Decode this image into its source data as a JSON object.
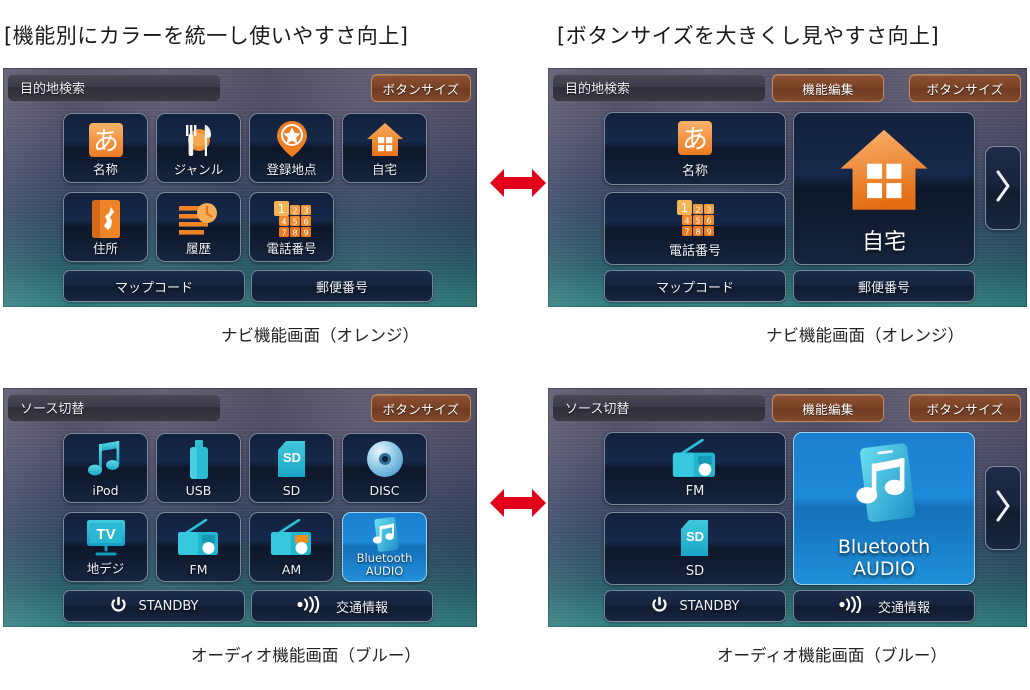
{
  "headings": {
    "left": "[機能別にカラーを統一し使いやすさ向上]",
    "right": "[ボタンサイズを大きくし見やすさ向上]"
  },
  "captions": {
    "nav_left": "ナビ機能画面（オレンジ）",
    "nav_right": "ナビ機能画面（オレンジ）",
    "audio_left": "オーディオ機能画面（ブルー）",
    "audio_right": "オーディオ機能画面（ブルー）"
  },
  "colors": {
    "accent_orange": "#F2903C",
    "accent_blue": "#29B6D8",
    "selected_blue": "#1E8AD8",
    "arrow_red": "#E3001B",
    "topbtn_brown": "#7A4327",
    "tile_navy": "#12213C"
  },
  "common": {
    "button_size_label": "ボタンサイズ",
    "function_edit_label": "機能編集",
    "next_page_icon": "chevron-right-icon"
  },
  "panels": {
    "nav_small": {
      "title": "目的地検索",
      "has_function_edit": false,
      "has_pager": false,
      "tiles": [
        {
          "label": "名称",
          "icon": "kana-a-icon"
        },
        {
          "label": "ジャンル",
          "icon": "genre-cutlery-icon"
        },
        {
          "label": "登録地点",
          "icon": "map-pin-star-icon"
        },
        {
          "label": "自宅",
          "icon": "home-icon"
        },
        {
          "label": "住所",
          "icon": "address-book-icon"
        },
        {
          "label": "履歴",
          "icon": "history-clock-icon"
        },
        {
          "label": "電話番号",
          "icon": "keypad-icon"
        }
      ],
      "bottom": [
        {
          "label": "マップコード",
          "icon": null
        },
        {
          "label": "郵便番号",
          "icon": null
        }
      ]
    },
    "nav_large": {
      "title": "目的地検索",
      "has_function_edit": true,
      "has_pager": true,
      "tiles": [
        {
          "label": "名称",
          "icon": "kana-a-icon"
        },
        {
          "label": "電話番号",
          "icon": "keypad-icon"
        },
        {
          "label": "自宅",
          "icon": "home-icon"
        }
      ],
      "bottom": [
        {
          "label": "マップコード",
          "icon": null
        },
        {
          "label": "郵便番号",
          "icon": null
        }
      ]
    },
    "audio_small": {
      "title": "ソース切替",
      "has_function_edit": false,
      "has_pager": false,
      "tiles": [
        {
          "label": "iPod",
          "icon": "music-note-icon"
        },
        {
          "label": "USB",
          "icon": "usb-stick-icon"
        },
        {
          "label": "SD",
          "icon": "sd-card-icon"
        },
        {
          "label": "DISC",
          "icon": "disc-icon"
        },
        {
          "label": "地デジ",
          "icon": "tv-icon"
        },
        {
          "label": "FM",
          "icon": "radio-fm-icon"
        },
        {
          "label": "AM",
          "icon": "radio-am-icon"
        },
        {
          "label": "Bluetooth AUDIO",
          "icon": "bluetooth-audio-icon",
          "selected": true
        }
      ],
      "bottom": [
        {
          "label": "STANDBY",
          "icon": "power-icon"
        },
        {
          "label": "交通情報",
          "icon": "traffic-broadcast-icon"
        }
      ]
    },
    "audio_large": {
      "title": "ソース切替",
      "has_function_edit": true,
      "has_pager": true,
      "tiles": [
        {
          "label": "FM",
          "icon": "radio-fm-icon"
        },
        {
          "label": "SD",
          "icon": "sd-card-icon"
        },
        {
          "label": "Bluetooth",
          "label2": "AUDIO",
          "icon": "bluetooth-audio-icon",
          "selected": true
        }
      ],
      "bottom": [
        {
          "label": "STANDBY",
          "icon": "power-icon"
        },
        {
          "label": "交通情報",
          "icon": "traffic-broadcast-icon"
        }
      ]
    }
  }
}
